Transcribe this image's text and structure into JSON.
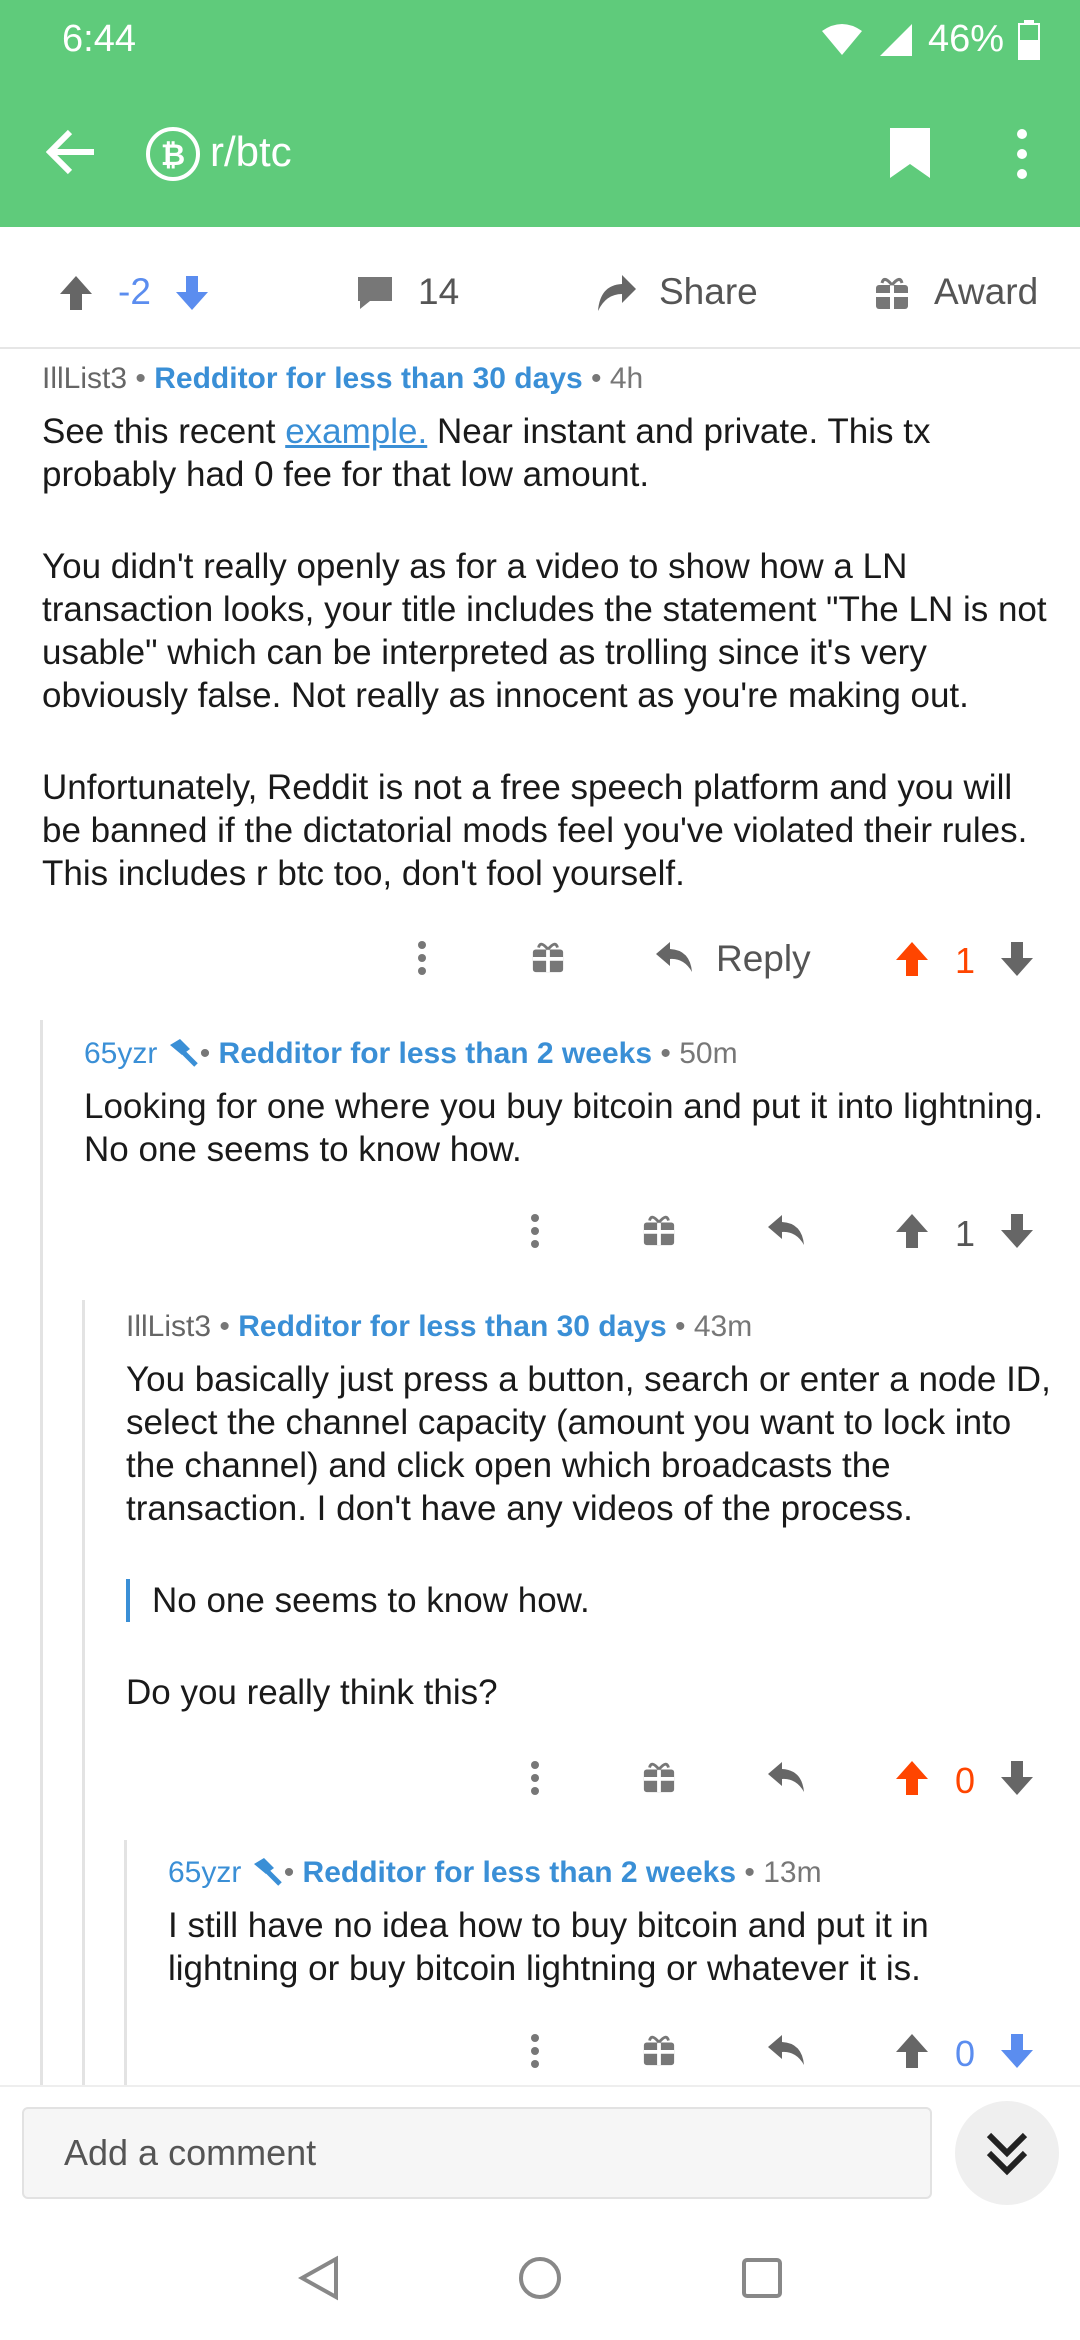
{
  "status": {
    "time": "6:44",
    "battery": "46%"
  },
  "header": {
    "subreddit": "r/btc",
    "icons": [
      "back-arrow-icon",
      "bitcoin-icon",
      "bookmark-icon",
      "more-vertical-icon"
    ]
  },
  "action_bar": {
    "score": "-2",
    "comments": "14",
    "share": "Share",
    "award": "Award"
  },
  "comments": [
    {
      "author": "IllList3",
      "flair": "Redditor for less than 30 days",
      "time": "4h",
      "p1_before": "See this recent ",
      "p1_link": "example.",
      "p1_after": "  Near instant and private.  This tx probably had 0 fee for that low amount.",
      "p2": "You didn't really openly as for a video to show how a LN transaction looks, your title includes the statement \"The LN is not usable\"  which can be interpreted as trolling since it's very obviously false.  Not really as innocent as you're making out.",
      "p3": "Unfortunately,  Reddit is not a free speech platform and you will be banned if the dictatorial mods feel you've violated their rules.  This includes r btc too, don't fool yourself.",
      "reply": "Reply",
      "score": "1"
    },
    {
      "author": "65yzr",
      "flair": "Redditor for less than 2 weeks",
      "time": "50m",
      "text": "Looking for one where you buy bitcoin and put it into lightning.  No one seems to know how.",
      "score": "1"
    },
    {
      "author": "IllList3",
      "flair": "Redditor for less than 30 days",
      "time": "43m",
      "p1": "You basically just press a button, search or enter a node ID, select the channel capacity (amount you want to lock into the channel) and click open which broadcasts the transaction.  I don't have any videos of the process.",
      "quote": "No one seems to know how.",
      "p2": "Do you really think this?",
      "score": "0"
    },
    {
      "author": "65yzr",
      "flair": "Redditor for less than 2 weeks",
      "time": "13m",
      "text": "I still have no idea how to buy bitcoin and put it in lightning or buy bitcoin lightning or whatever it is.",
      "score": "0"
    }
  ],
  "composer": {
    "placeholder": "Add a comment"
  },
  "colors": {
    "header": "#5fcb7b",
    "upvote": "#ff4500",
    "downvote": "#5b8def",
    "flair": "#3a8fd6"
  }
}
